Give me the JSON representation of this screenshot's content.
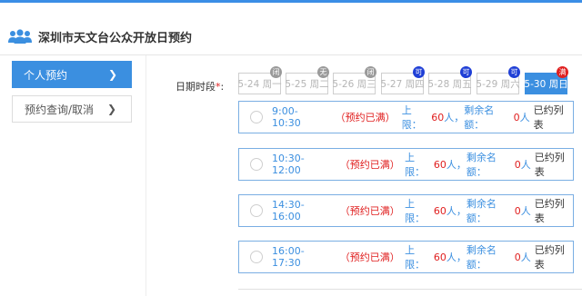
{
  "page": {
    "title": "深圳市天文台公众开放日预约",
    "icon": "people-icon",
    "accent": "#3b8fe0"
  },
  "sidebar": {
    "items": [
      {
        "label": "个人预约",
        "active": true
      },
      {
        "label": "预约查询/取消",
        "active": false
      }
    ]
  },
  "date_picker": {
    "label": "日期时段",
    "required_mark": "*",
    "colon": ":",
    "dates": [
      {
        "label": "5-24 周一",
        "badge": "闭",
        "badge_color": "#9a9a9a",
        "selected": false
      },
      {
        "label": "5-25 周二",
        "badge": "无",
        "badge_color": "#9a9a9a",
        "selected": false
      },
      {
        "label": "5-26 周三",
        "badge": "闭",
        "badge_color": "#9a9a9a",
        "selected": false
      },
      {
        "label": "5-27 周四",
        "badge": "可",
        "badge_color": "#1f3fd6",
        "selected": false
      },
      {
        "label": "5-28 周五",
        "badge": "可",
        "badge_color": "#1f3fd6",
        "selected": false
      },
      {
        "label": "5-29 周六",
        "badge": "可",
        "badge_color": "#1f3fd6",
        "selected": false
      },
      {
        "label": "5-30 周日",
        "badge": "满",
        "badge_color": "#e02020",
        "selected": true
      }
    ]
  },
  "slots": [
    {
      "time": "9:00-10:30",
      "status": "（预约已满）",
      "limit_label": "上限：",
      "limit": "60",
      "unit1": "人，",
      "remaining_label": "剩余名额：",
      "remaining": "0",
      "unit2": "人",
      "booked_list": "已约列表"
    },
    {
      "time": "10:30-12:00",
      "status": "（预约已满）",
      "limit_label": "上限：",
      "limit": "60",
      "unit1": "人，",
      "remaining_label": "剩余名额：",
      "remaining": "0",
      "unit2": "人",
      "booked_list": "已约列表"
    },
    {
      "time": "14:30-16:00",
      "status": "（预约已满）",
      "limit_label": "上限：",
      "limit": "60",
      "unit1": "人，",
      "remaining_label": "剩余名额：",
      "remaining": "0",
      "unit2": "人",
      "booked_list": "已约列表"
    },
    {
      "time": "16:00-17:30",
      "status": "（预约已满）",
      "limit_label": "上限：",
      "limit": "60",
      "unit1": "人，",
      "remaining_label": "剩余名额：",
      "remaining": "0",
      "unit2": "人",
      "booked_list": "已约列表"
    }
  ]
}
